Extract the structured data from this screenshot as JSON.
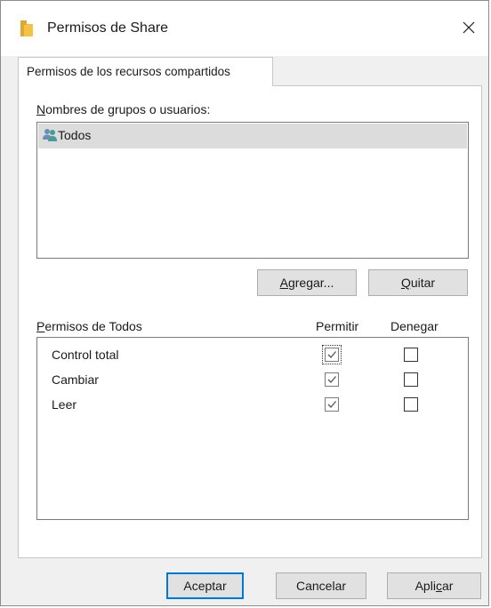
{
  "window": {
    "title": "Permisos de Share",
    "icon": "folder-icon",
    "close_icon": "close-icon"
  },
  "tab": {
    "label": "Permisos de los recursos compartidos"
  },
  "groups": {
    "label_prefix": "N",
    "label_rest": "ombres de grupos o usuarios:",
    "items": [
      {
        "name": "Todos",
        "icon": "users-group-icon",
        "selected": true
      }
    ]
  },
  "group_buttons": {
    "add_prefix": "A",
    "add_rest": "gregar...",
    "remove_prefix": "Q",
    "remove_rest": "uitar"
  },
  "permissions": {
    "label_prefix": "P",
    "label_rest": "ermisos de Todos",
    "col_allow": "Permitir",
    "col_deny": "Denegar",
    "rows": [
      {
        "name": "Control total",
        "allow": true,
        "deny": false
      },
      {
        "name": "Cambiar",
        "allow": true,
        "deny": false
      },
      {
        "name": "Leer",
        "allow": true,
        "deny": false
      }
    ]
  },
  "footer": {
    "ok": "Aceptar",
    "cancel": "Cancelar",
    "apply_pre": "Apli",
    "apply_underlined": "c",
    "apply_post": "ar"
  },
  "colors": {
    "accent_border": "#0078d7",
    "folder": "#f5c242",
    "selection_bg": "#dcdcdc"
  }
}
